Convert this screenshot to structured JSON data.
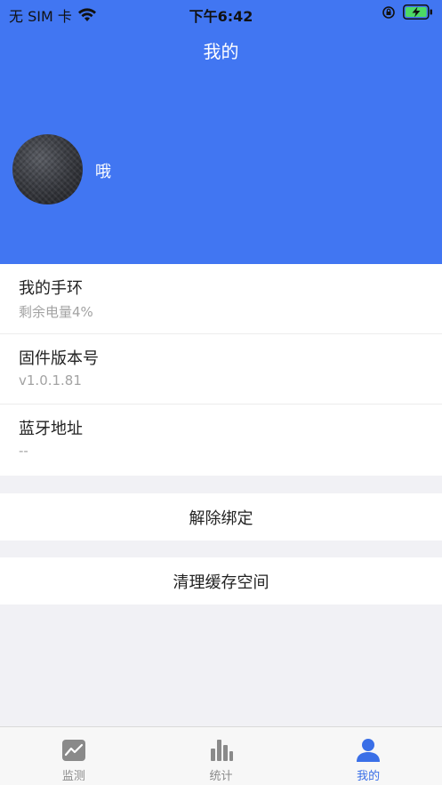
{
  "status_bar": {
    "carrier": "无 SIM 卡",
    "time": "下午6:42"
  },
  "nav": {
    "title": "我的"
  },
  "profile": {
    "username": "哦"
  },
  "info_items": [
    {
      "title": "我的手环",
      "value": "剩余电量4%"
    },
    {
      "title": "固件版本号",
      "value": "v1.0.1.81"
    },
    {
      "title": "蓝牙地址",
      "value": "--"
    }
  ],
  "actions": {
    "unbind": "解除绑定",
    "clear_cache": "清理缓存空间"
  },
  "tabbar": {
    "tabs": [
      {
        "label": "监测",
        "icon": "monitor-chart-icon",
        "active": false
      },
      {
        "label": "统计",
        "icon": "bar-chart-icon",
        "active": false
      },
      {
        "label": "我的",
        "icon": "person-icon",
        "active": true
      }
    ]
  },
  "colors": {
    "accent": "#4176f2",
    "active_tab": "#3a6fe7",
    "inactive_tab": "#8a8a8a",
    "battery_fill": "#4cd964"
  }
}
